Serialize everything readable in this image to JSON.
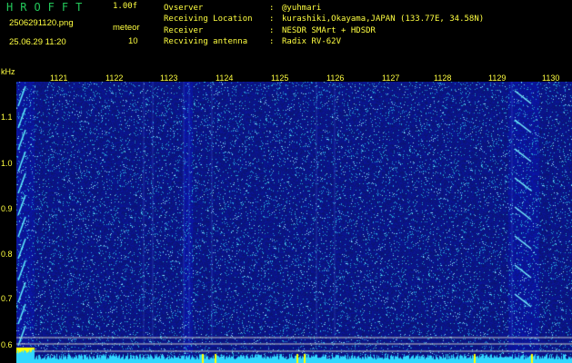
{
  "header": {
    "app_title": "HROFFT",
    "version": "1.00f",
    "filename": "2506291120.png",
    "meteor_label": "meteor",
    "datetime": "25.06.29 11:20",
    "meteor_count": "10"
  },
  "info": [
    {
      "key": "Ovserver",
      "sep": ":",
      "value": "@yuhmari"
    },
    {
      "key": "Receiving Location",
      "sep": ":",
      "value": "kurashiki,Okayama,JAPAN (133.77E, 34.58N)"
    },
    {
      "key": "Receiver",
      "sep": ":",
      "value": "NESDR SMArt + HDSDR"
    },
    {
      "key": "Recviving antenna",
      "sep": ":",
      "value": "Radix RV-62V"
    }
  ],
  "axis": {
    "y_unit": "kHz",
    "x_ticks": [
      "1121",
      "1122",
      "1123",
      "1124",
      "1125",
      "1126",
      "1127",
      "1128",
      "1129",
      "1130"
    ],
    "y_ticks": [
      "1.1",
      "1.0",
      "0.9",
      "0.8",
      "0.7",
      "0.6"
    ]
  },
  "colors": {
    "background": "#000000",
    "label_yellow": "#ffff40",
    "title_green": "#23c85a",
    "spectrogram_blue": "#1a2a9a",
    "signal_cyan": "#3cdcff"
  }
}
